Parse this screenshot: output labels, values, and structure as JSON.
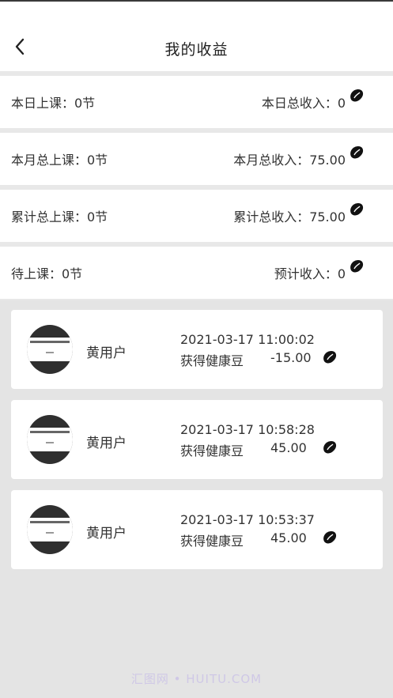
{
  "header": {
    "title": "我的收益"
  },
  "stats": [
    {
      "left": "本日上课：0节",
      "right": "本日总收入：0"
    },
    {
      "left": "本月总上课：0节",
      "right": "本月总收入：75.00"
    },
    {
      "left": "累计总上课：0节",
      "right": "累计总收入：75.00"
    },
    {
      "left": "待上课：0节",
      "right": "预计收入：0"
    }
  ],
  "records": [
    {
      "user": "黄用户",
      "time": "2021-03-17 11:00:02",
      "desc": "获得健康豆",
      "amount": "-15.00"
    },
    {
      "user": "黄用户",
      "time": "2021-03-17 10:58:28",
      "desc": "获得健康豆",
      "amount": "45.00"
    },
    {
      "user": "黄用户",
      "time": "2021-03-17 10:53:37",
      "desc": "获得健康豆",
      "amount": "45.00"
    }
  ],
  "icons": {
    "back": "chevron-left-icon",
    "bean": "bean-icon"
  },
  "watermark": "汇图网 • HUITU.COM",
  "colors": {
    "bean": "#111111",
    "divider": "#e8e8e8"
  }
}
